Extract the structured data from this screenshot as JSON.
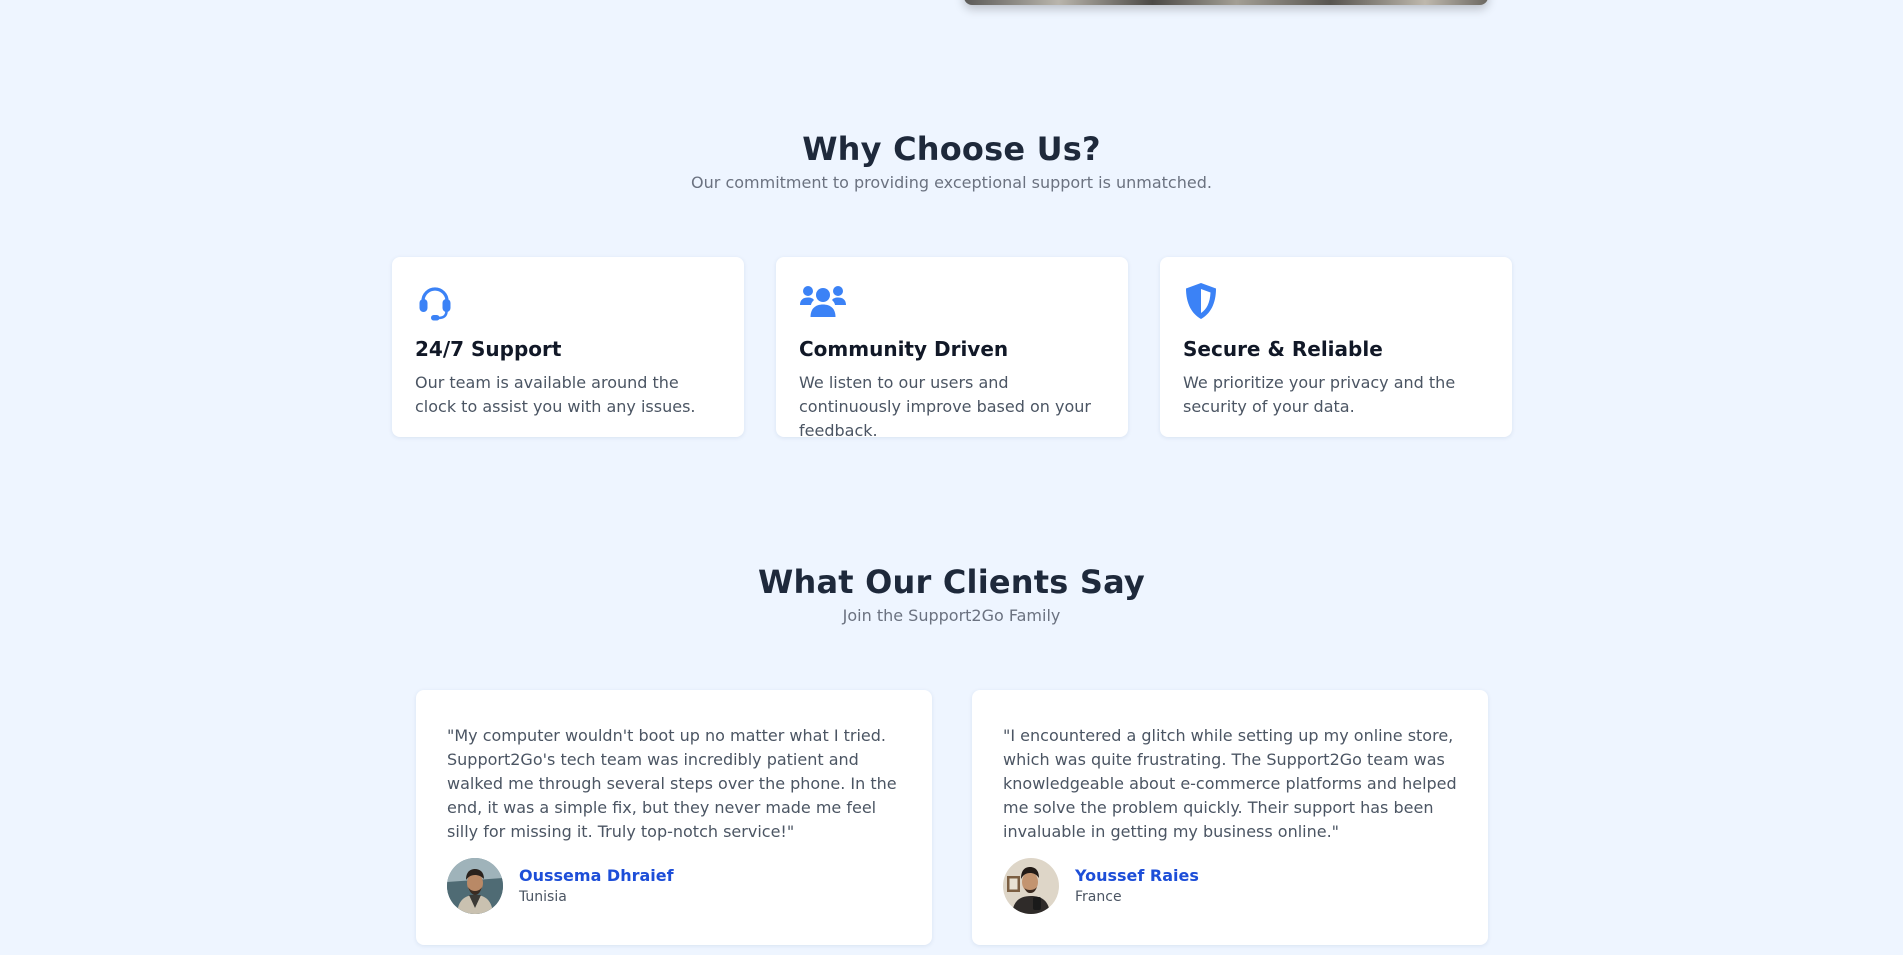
{
  "why": {
    "title": "Why Choose Us?",
    "subtitle": "Our commitment to providing exceptional support is unmatched.",
    "features": [
      {
        "icon": "headset-icon",
        "title": "24/7 Support",
        "text": "Our team is available around the clock to assist you with any issues."
      },
      {
        "icon": "users-icon",
        "title": "Community Driven",
        "text": "We listen to our users and continuously improve based on your feedback."
      },
      {
        "icon": "shield-icon",
        "title": "Secure & Reliable",
        "text": "We prioritize your privacy and the security of your data."
      }
    ]
  },
  "clients": {
    "title": "What Our Clients Say",
    "subtitle": "Join the Support2Go Family",
    "testimonials": [
      {
        "quote": "\"My computer wouldn't boot up no matter what I tried. Support2Go's tech team was incredibly patient and walked me through several steps over the phone. In the end, it was a simple fix, but they never made me feel silly for missing it. Truly top-notch service!\"",
        "name": "Oussema Dhraief",
        "country": "Tunisia"
      },
      {
        "quote": "\"I encountered a glitch while setting up my online store, which was quite frustrating. The Support2Go team was knowledgeable about e-commerce platforms and helped me solve the problem quickly. Their support has been invaluable in getting my business online.\"",
        "name": "Youssef Raies",
        "country": "France"
      }
    ]
  },
  "colors": {
    "page_background": "#eef5ff",
    "accent": "#3b82f6",
    "author_name": "#1d4ed8"
  }
}
